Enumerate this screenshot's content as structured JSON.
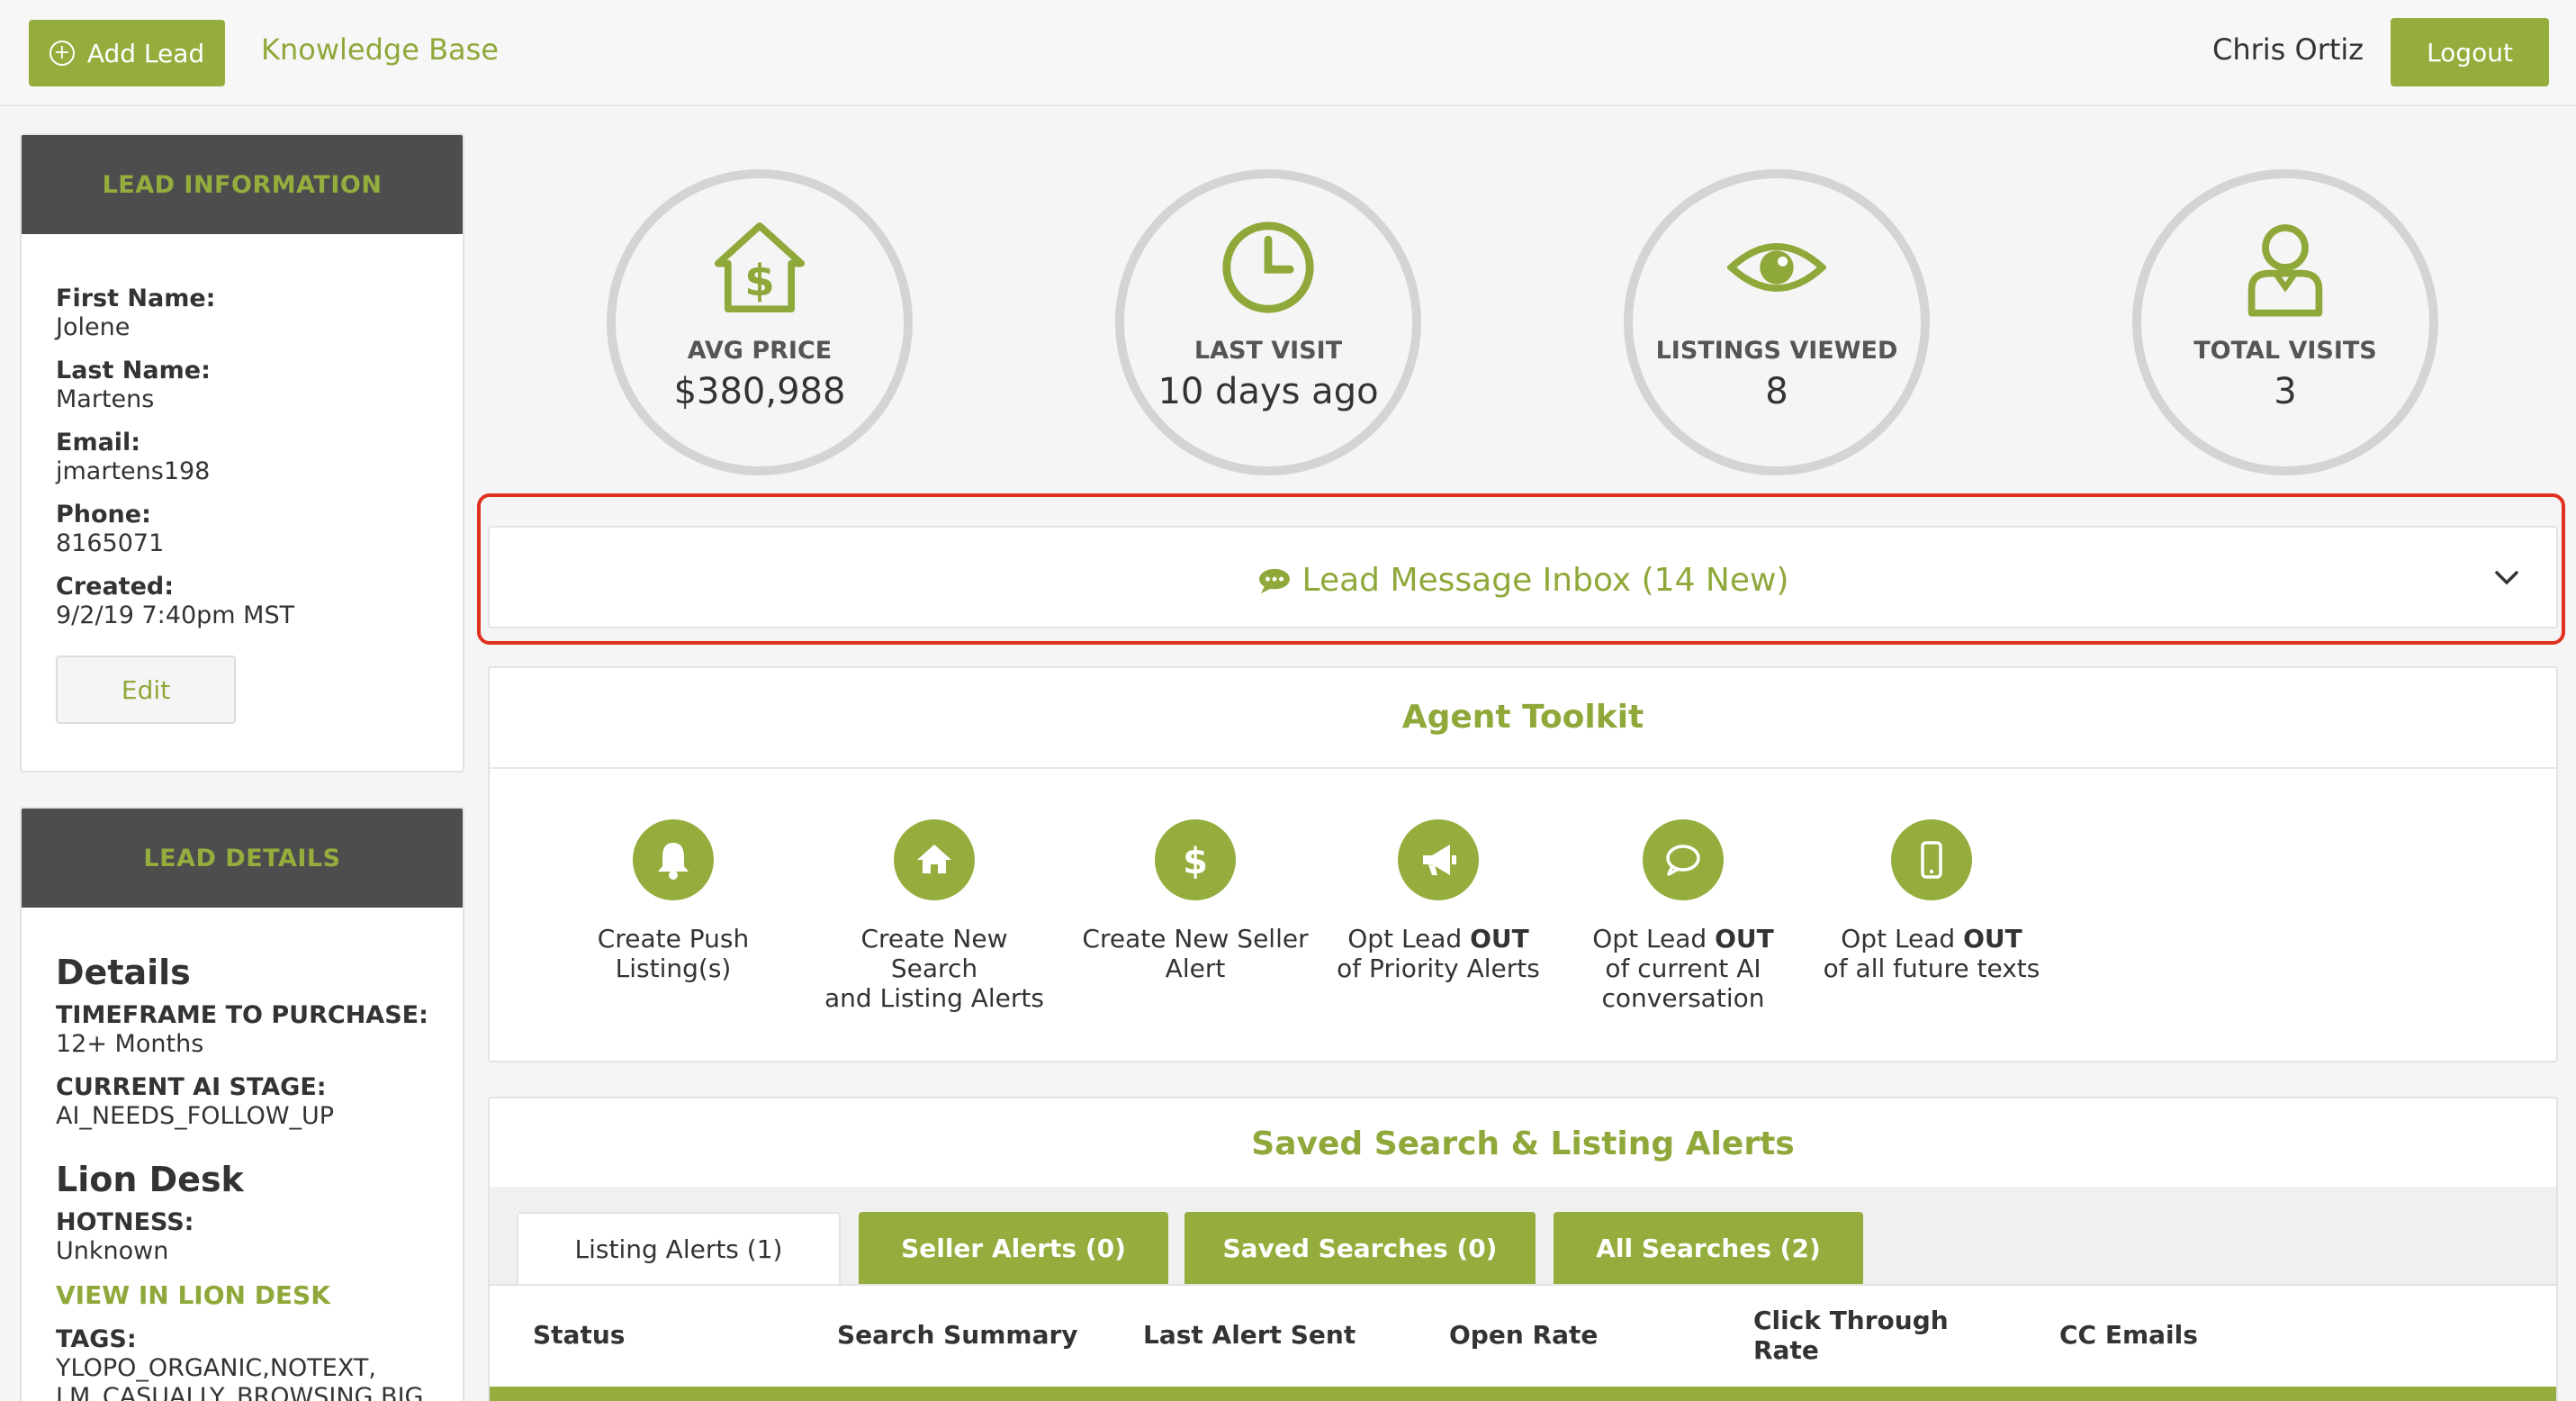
{
  "topbar": {
    "add_lead_label": "Add Lead",
    "knowledge_base_label": "Knowledge Base",
    "user_name": "Chris Ortiz",
    "logout_label": "Logout"
  },
  "lead_info": {
    "header": "LEAD INFORMATION",
    "first_name_label": "First Name:",
    "first_name": "Jolene",
    "last_name_label": "Last Name:",
    "last_name": "Martens",
    "email_label": "Email:",
    "email": "jmartens198",
    "phone_label": "Phone:",
    "phone": "8165071",
    "created_label": "Created:",
    "created": "9/2/19 7:40pm MST",
    "edit_label": "Edit"
  },
  "lead_details": {
    "header": "LEAD DETAILS",
    "details_heading": "Details",
    "timeframe_label": "TIMEFRAME TO PURCHASE:",
    "timeframe": "12+ Months",
    "ai_stage_label": "CURRENT AI STAGE:",
    "ai_stage": "AI_NEEDS_FOLLOW_UP",
    "lion_desk_heading": "Lion Desk",
    "hotness_label": "HOTNESS:",
    "hotness": "Unknown",
    "view_link": "VIEW IN LION DESK",
    "tags_label": "TAGS:",
    "tags_line1": "YLOPO_ORGANIC,NOTEXT,",
    "tags_line2": "LM_CASUALLY_BROWSING,BIG"
  },
  "stats": [
    {
      "label": "AVG PRICE",
      "value": "$380,988",
      "icon": "house-dollar-icon"
    },
    {
      "label": "LAST VISIT",
      "value": "10 days ago",
      "icon": "clock-icon"
    },
    {
      "label": "LISTINGS VIEWED",
      "value": "8",
      "icon": "eye-icon"
    },
    {
      "label": "TOTAL VISITS",
      "value": "3",
      "icon": "person-icon"
    }
  ],
  "inbox": {
    "title": "Lead Message Inbox (14 New)"
  },
  "toolkit": {
    "title": "Agent Toolkit",
    "items": [
      {
        "line1": "Create Push",
        "line2": "Listing(s)",
        "icon": "bell-icon"
      },
      {
        "line1": "Create New Search",
        "line2": "and Listing Alerts",
        "icon": "house-icon"
      },
      {
        "line1": "Create New Seller",
        "line2": "Alert",
        "icon": "dollar-icon"
      },
      {
        "line1a": "Opt Lead ",
        "line1b": "OUT",
        "line2": "of Priority Alerts",
        "icon": "megaphone-icon"
      },
      {
        "line1a": "Opt Lead ",
        "line1b": "OUT",
        "line2": "of current AI",
        "line3": "conversation",
        "icon": "chat-icon"
      },
      {
        "line1a": "Opt Lead ",
        "line1b": "OUT",
        "line2": "of all future texts",
        "icon": "phone-icon"
      }
    ]
  },
  "saved": {
    "title": "Saved Search & Listing Alerts",
    "tabs": [
      "Listing Alerts (1)",
      "Seller Alerts (0)",
      "Saved Searches (0)",
      "All Searches (2)"
    ],
    "columns": [
      "Status",
      "Search Summary",
      "Last Alert Sent",
      "Open Rate",
      "Click Through",
      "Rate",
      "CC Emails"
    ]
  },
  "colors": {
    "accent": "#95ad3d",
    "highlight": "#e0301e",
    "panel_header": "#4d4d4d"
  }
}
